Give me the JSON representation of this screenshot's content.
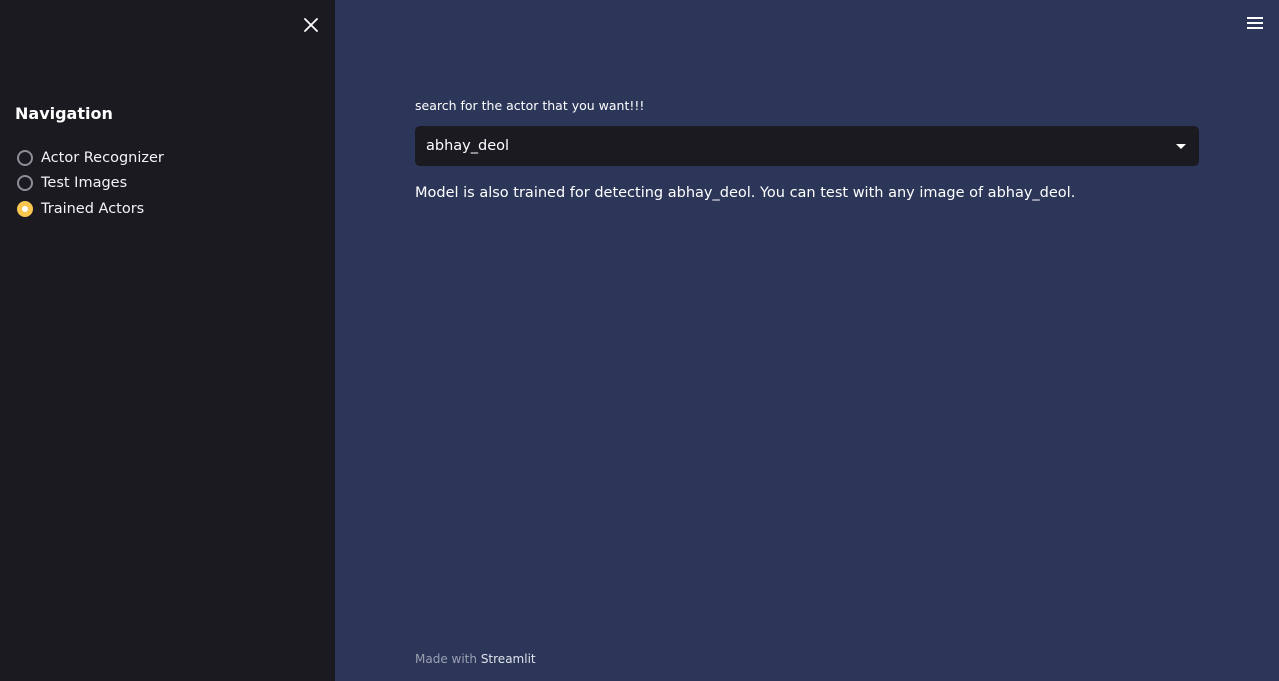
{
  "sidebar": {
    "close_icon": "close-icon",
    "title": "Navigation",
    "options": [
      {
        "label": "Actor Recognizer",
        "selected": false
      },
      {
        "label": "Test Images",
        "selected": false
      },
      {
        "label": "Trained Actors",
        "selected": true
      }
    ]
  },
  "header": {
    "menu_icon": "hamburger-menu-icon"
  },
  "main": {
    "select_label": "search for the actor that you want!!!",
    "select_value": "abhay_deol",
    "info_text": "Model is also trained for detecting abhay_deol. You can test with any image of abhay_deol."
  },
  "footer": {
    "prefix": "Made with",
    "brand": "Streamlit"
  },
  "colors": {
    "main_bg": "#2c3659",
    "sidebar_bg": "#1b1a20",
    "accent": "#f9c74f"
  }
}
